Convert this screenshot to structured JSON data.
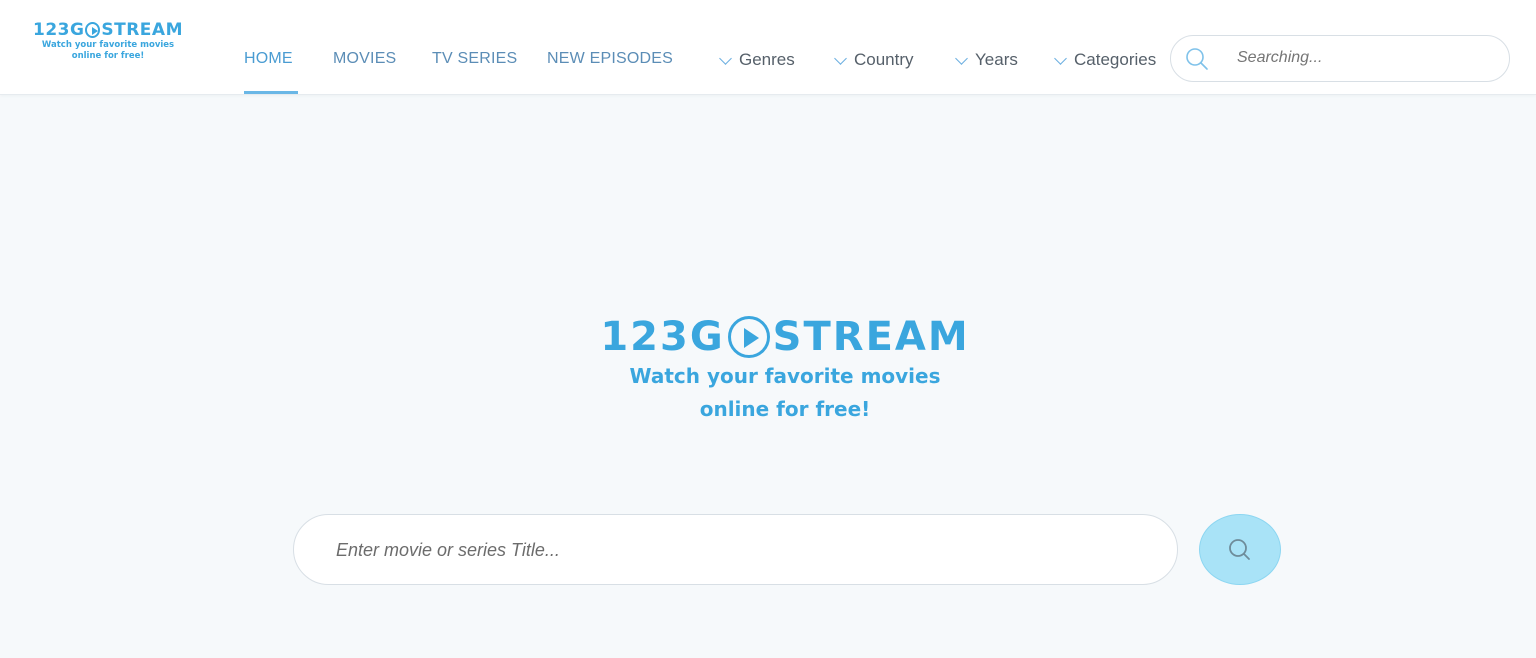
{
  "brand": {
    "name_left": "123G",
    "name_right": "STREAM",
    "tagline_line1": "Watch your favorite movies",
    "tagline_line2": "online for free!",
    "color": "#3aa6de"
  },
  "nav": {
    "items": [
      {
        "label": "HOME",
        "active": true
      },
      {
        "label": "MOVIES"
      },
      {
        "label": "TV SERIES"
      },
      {
        "label": "NEW EPISODES"
      }
    ],
    "dropdowns": [
      {
        "label": "Genres"
      },
      {
        "label": "Country"
      },
      {
        "label": "Years"
      },
      {
        "label": "Categories"
      }
    ]
  },
  "header_search": {
    "placeholder": "Searching...",
    "icon": "search-icon"
  },
  "hero": {
    "search_placeholder": "Enter movie or series Title...",
    "search_button_icon": "search-icon",
    "button_color": "#a9e3f7"
  }
}
